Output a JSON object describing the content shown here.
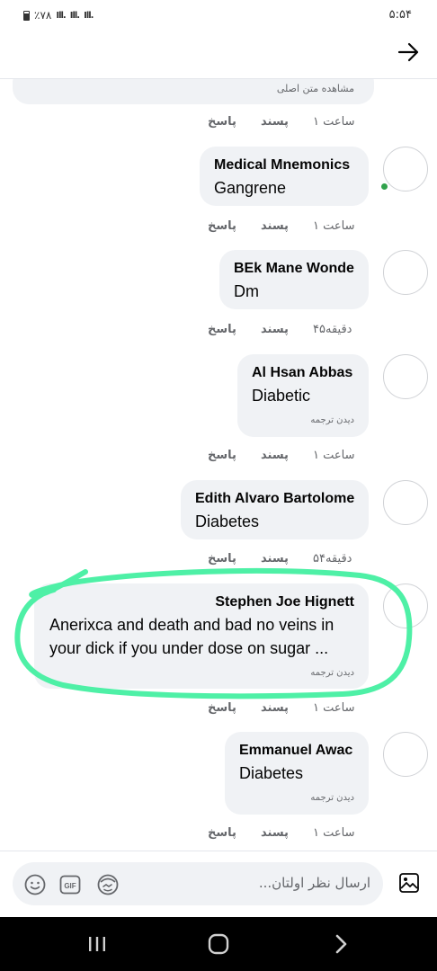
{
  "status_bar": {
    "battery_text": "٪۷۸",
    "time": "۵:۵۴"
  },
  "comments_partial": {
    "see_original": "مشاهده متن اصلی"
  },
  "actions": {
    "like": "پسند",
    "reply": "پاسخ"
  },
  "comments": [
    {
      "author": "Medical Mnemonics",
      "text": "Gangrene",
      "time": "۱ ساعت",
      "translate": ""
    },
    {
      "author": "BEk Mane Wonde",
      "text": "Dm",
      "time": "۴۵دقیقه",
      "translate": ""
    },
    {
      "author": "Al Hsan Abbas",
      "text": "Diabetic",
      "time": "۱ ساعت",
      "translate": "دیدن ترجمه"
    },
    {
      "author": "Edith Alvaro Bartolome",
      "text": "Diabetes",
      "time": "۵۴دقیقه",
      "translate": ""
    },
    {
      "author": "Stephen Joe Hignett",
      "text_line1": "Anerixca and death and bad no veins in",
      "text_line2": "your dick if you under dose on sugar ...",
      "time": "۱ ساعت",
      "translate": "دیدن ترجمه"
    },
    {
      "author": "Emmanuel Awac",
      "text": "Diabetes",
      "time": "۱ ساعت",
      "translate": "دیدن ترجمه"
    }
  ],
  "first_time": "۱ ساعت",
  "compose": {
    "placeholder": "ارسال نظر اولتان..."
  },
  "icons": [
    "back-arrow-icon",
    "photo-icon",
    "emoji-icon",
    "gif-icon",
    "avatar-sticker-icon",
    "recents-icon",
    "home-icon",
    "back-icon"
  ],
  "colors": {
    "highlight": "#4ef0a6",
    "online": "#31a24c",
    "bubble": "#f0f2f5"
  }
}
